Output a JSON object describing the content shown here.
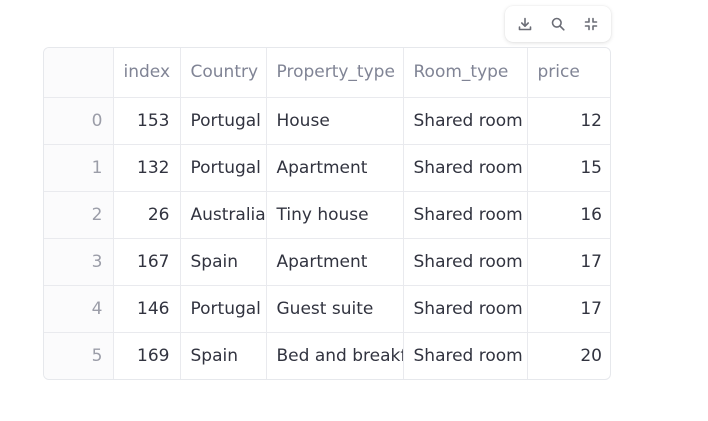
{
  "toolbar": {
    "icons": [
      "download-icon",
      "search-icon",
      "collapse-icon"
    ]
  },
  "table": {
    "columns": [
      "index",
      "Country",
      "Property_type",
      "Room_type",
      "price"
    ],
    "rows": [
      {
        "row": "0",
        "index": "153",
        "country": "Portugal",
        "property_type": "House",
        "room_type": "Shared room",
        "price": "12"
      },
      {
        "row": "1",
        "index": "132",
        "country": "Portugal",
        "property_type": "Apartment",
        "room_type": "Shared room",
        "price": "15"
      },
      {
        "row": "2",
        "index": "26",
        "country": "Australia",
        "property_type": "Tiny house",
        "room_type": "Shared room",
        "price": "16"
      },
      {
        "row": "3",
        "index": "167",
        "country": "Spain",
        "property_type": "Apartment",
        "room_type": "Shared room",
        "price": "17"
      },
      {
        "row": "4",
        "index": "146",
        "country": "Portugal",
        "property_type": "Guest suite",
        "room_type": "Shared room",
        "price": "17"
      },
      {
        "row": "5",
        "index": "169",
        "country": "Spain",
        "property_type": "Bed and breakfast",
        "room_type": "Shared room",
        "price": "20"
      }
    ]
  }
}
